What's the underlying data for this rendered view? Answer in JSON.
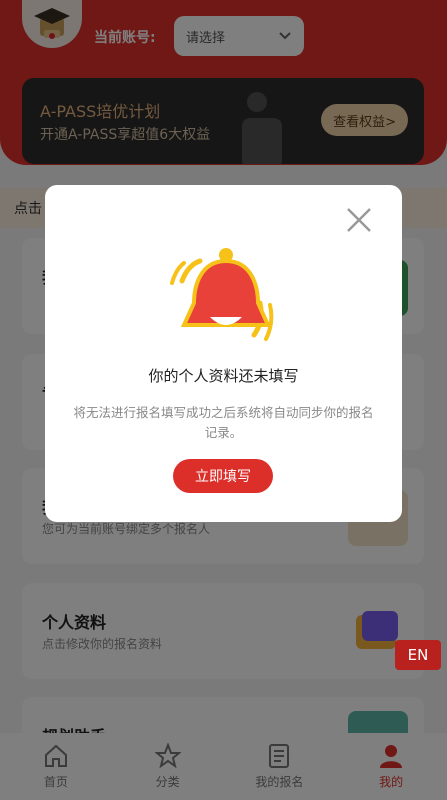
{
  "header": {
    "account_label": "当前账号:",
    "account_select_placeholder": "请选择",
    "vip_title": "A-PASS培优计划",
    "vip_subtitle": "开通A-PASS享超值6大权益",
    "vip_button": "查看权益>"
  },
  "notice": {
    "text": "点击"
  },
  "cards": [
    {
      "title": "我",
      "subtitle": ""
    },
    {
      "title": "专",
      "subtitle": ""
    },
    {
      "title": "我",
      "subtitle": "您可为当前账号绑定多个报名人"
    },
    {
      "title": "个人资料",
      "subtitle": "点击修改你的报名资料"
    },
    {
      "title": "规划助手",
      "subtitle": ""
    }
  ],
  "tabbar": [
    {
      "label": "首页",
      "icon": "home-icon"
    },
    {
      "label": "分类",
      "icon": "star-icon"
    },
    {
      "label": "我的报名",
      "icon": "list-icon"
    },
    {
      "label": "我的",
      "icon": "person-icon"
    }
  ],
  "modal": {
    "title": "你的个人资料还未填写",
    "description": "将无法进行报名填写成功之后系统将自动同步你的报名记录。",
    "button": "立即填写"
  },
  "floating": {
    "lang": "EN"
  },
  "colors": {
    "primary": "#e0302b",
    "vip_gold": "#e8b47e"
  }
}
